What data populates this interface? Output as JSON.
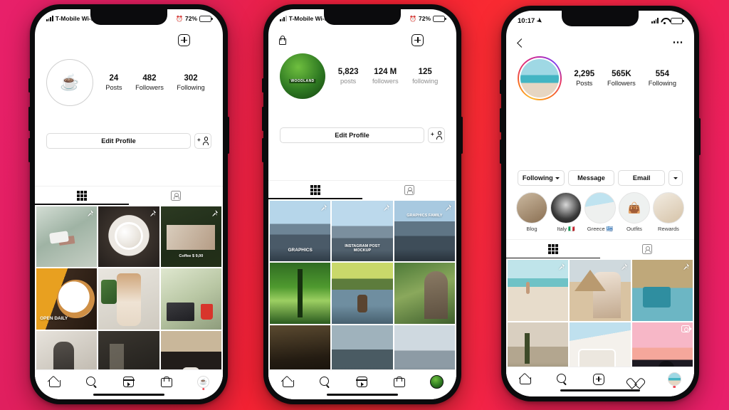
{
  "background": {
    "color_left": "#e8206a",
    "color_mid": "#f42233",
    "color_right": "#e71f6c"
  },
  "phones": [
    {
      "id": "phone-1",
      "status_bar": {
        "carrier": "T-Mobile Wi-Fi",
        "battery_percent": "72%",
        "low_power_icon": "low-power-icon",
        "signal": "signal-bars-icon",
        "wifi": "wifi-icon"
      },
      "header": {
        "left_icon": "",
        "add_icon": "plus-box-icon",
        "menu_icon": "hamburger-icon"
      },
      "profile": {
        "avatar_type": "coffee-cup-logo",
        "avatar_glyph": "☕",
        "stats": [
          {
            "num": "24",
            "label": "Posts"
          },
          {
            "num": "482",
            "label": "Followers"
          },
          {
            "num": "302",
            "label": "Following"
          }
        ]
      },
      "actions": {
        "primary": "Edit Profile",
        "add_person_icon": "add-person-icon"
      },
      "highlights": [],
      "tabs": {
        "grid": "grid-tab-icon",
        "tagged": "tagged-tab-icon",
        "active": "grid"
      },
      "grid": [
        {
          "art": "a-coffee1",
          "pin": true,
          "reel": false,
          "label": ""
        },
        {
          "art": "a-coffee2",
          "pin": true,
          "reel": false,
          "label": ""
        },
        {
          "art": "a-coffee3",
          "pin": true,
          "reel": false,
          "label": "Coffee  $ 9,00"
        },
        {
          "art": "a-open",
          "pin": false,
          "reel": false,
          "label": "OPEN DAILY"
        },
        {
          "art": "a-shake",
          "pin": false,
          "reel": false,
          "label": ""
        },
        {
          "art": "a-desk",
          "pin": false,
          "reel": false,
          "label": ""
        },
        {
          "art": "a-barista",
          "pin": false,
          "reel": false,
          "label": ""
        },
        {
          "art": "a-shopfront",
          "pin": false,
          "reel": false,
          "label": ""
        },
        {
          "art": "a-cafe",
          "pin": false,
          "reel": false,
          "label": ""
        }
      ],
      "bottom_nav": [
        {
          "icon": "home-icon",
          "name": "nav-home"
        },
        {
          "icon": "search-icon",
          "name": "nav-search"
        },
        {
          "icon": "reels-icon",
          "name": "nav-reels"
        },
        {
          "icon": "shop-icon",
          "name": "nav-shop"
        },
        {
          "icon": "profile-avatar-icon",
          "name": "nav-profile"
        }
      ]
    },
    {
      "id": "phone-2",
      "status_bar": {
        "carrier": "T-Mobile Wi-Fi",
        "battery_percent": "72%",
        "low_power_icon": "low-power-icon",
        "signal": "signal-bars-icon",
        "wifi": "wifi-icon"
      },
      "header": {
        "left_icon": "lock-icon",
        "add_icon": "plus-box-icon",
        "menu_icon": "hamburger-icon"
      },
      "profile": {
        "avatar_type": "woodland-logo",
        "avatar_text": "WOODLAND",
        "stats": [
          {
            "num": "5,823",
            "label": "posts"
          },
          {
            "num": "124 M",
            "label": "followers"
          },
          {
            "num": "125",
            "label": "following"
          }
        ]
      },
      "actions": {
        "primary": "Edit Profile",
        "add_person_icon": "add-person-icon"
      },
      "highlights": [],
      "tabs": {
        "grid": "grid-tab-icon",
        "tagged": "tagged-tab-icon",
        "active": "grid"
      },
      "grid": [
        {
          "art": "a-mtn1",
          "pin": true,
          "reel": false,
          "label": "GRAPHICS"
        },
        {
          "art": "a-mtn2",
          "pin": true,
          "reel": false,
          "label": "INSTAGRAM POST MOCKUP"
        },
        {
          "art": "a-mtn3",
          "pin": true,
          "reel": false,
          "label": "GRAPHICS FAMILY"
        },
        {
          "art": "a-forest",
          "pin": false,
          "reel": false,
          "label": ""
        },
        {
          "art": "a-lake",
          "pin": false,
          "reel": false,
          "label": ""
        },
        {
          "art": "a-girlnature",
          "pin": false,
          "reel": false,
          "label": ""
        },
        {
          "art": "a-dark1",
          "pin": false,
          "reel": false,
          "label": ""
        },
        {
          "art": "a-dark2",
          "pin": false,
          "reel": false,
          "label": ""
        },
        {
          "art": "a-dark3",
          "pin": false,
          "reel": false,
          "label": ""
        }
      ],
      "bottom_nav": [
        {
          "icon": "home-icon",
          "name": "nav-home"
        },
        {
          "icon": "search-icon",
          "name": "nav-search"
        },
        {
          "icon": "reels-icon",
          "name": "nav-reels"
        },
        {
          "icon": "shop-icon",
          "name": "nav-shop"
        },
        {
          "icon": "profile-avatar-icon",
          "name": "nav-profile"
        }
      ]
    },
    {
      "id": "phone-3",
      "status_bar": {
        "time": "10:17",
        "location_icon": "location-arrow-icon",
        "signal": "signal-bars-icon",
        "wifi": "wifi-icon",
        "battery": "battery-icon"
      },
      "header": {
        "back_icon": "chevron-left-icon",
        "more_icon": "more-dots-icon"
      },
      "profile": {
        "avatar_type": "beach-photo",
        "ring": "story-gradient-ring",
        "stats": [
          {
            "num": "2,295",
            "label": "Posts"
          },
          {
            "num": "565K",
            "label": "Followers"
          },
          {
            "num": "554",
            "label": "Following"
          }
        ]
      },
      "actions": {
        "following": "Following",
        "following_caret": "chevron-down-icon",
        "message": "Message",
        "email": "Email",
        "more_caret": "chevron-down-icon"
      },
      "highlights": [
        {
          "name": "Blog",
          "art": "a-hl-blog",
          "glyph": ""
        },
        {
          "name": "Italy 🇮🇹",
          "art": "a-hl-italy",
          "glyph": ""
        },
        {
          "name": "Greece 🇬🇷",
          "art": "a-hl-greece",
          "glyph": ""
        },
        {
          "name": "Outfits",
          "art": "a-hl-outfits",
          "glyph": "👜"
        },
        {
          "name": "Rewards",
          "art": "a-hl-rewards",
          "glyph": ""
        }
      ],
      "tabs": {
        "grid": "grid-tab-icon",
        "tagged": "tagged-tab-icon",
        "active": "grid"
      },
      "grid": [
        {
          "art": "a-beach",
          "pin": true,
          "reel": false,
          "label": ""
        },
        {
          "art": "a-pyramid",
          "pin": true,
          "reel": false,
          "label": ""
        },
        {
          "art": "a-bridge",
          "pin": true,
          "reel": false,
          "label": ""
        },
        {
          "art": "a-desert",
          "pin": false,
          "reel": false,
          "label": ""
        },
        {
          "art": "a-santorini",
          "pin": false,
          "reel": false,
          "label": ""
        },
        {
          "art": "a-sunset",
          "pin": false,
          "reel": true,
          "label": ""
        }
      ],
      "bottom_nav": [
        {
          "icon": "home-icon",
          "name": "nav-home"
        },
        {
          "icon": "search-icon",
          "name": "nav-search"
        },
        {
          "icon": "plus-icon",
          "name": "nav-create"
        },
        {
          "icon": "heart-icon",
          "name": "nav-activity"
        },
        {
          "icon": "profile-avatar-icon",
          "name": "nav-profile"
        }
      ]
    }
  ]
}
